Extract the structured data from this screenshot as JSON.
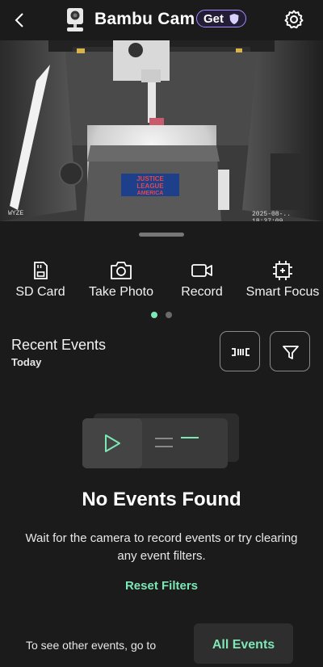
{
  "header": {
    "title": "Bambu Cam",
    "get_badge": "Get"
  },
  "video": {
    "watermark_brand": "WYZE",
    "timestamp": "2025-08-.. 18:37:09",
    "sign_text_line1": "JUSTICE",
    "sign_text_line2": "LEAGUE",
    "sign_text_line3": "AMERICA"
  },
  "actions": [
    {
      "label": "SD Card",
      "icon": "sd-card-icon"
    },
    {
      "label": "Take Photo",
      "icon": "camera-icon"
    },
    {
      "label": "Record",
      "icon": "video-record-icon"
    },
    {
      "label": "Smart Focus",
      "icon": "focus-icon"
    }
  ],
  "pager": {
    "pages": 2,
    "active": 1
  },
  "events": {
    "title": "Recent Events",
    "subtitle": "Today"
  },
  "empty": {
    "title": "No Events Found",
    "description": "Wait for the camera to record events or try clearing any event filters.",
    "reset_label": "Reset Filters"
  },
  "footer": {
    "text": "To see other events, go to",
    "button_label": "All Events"
  },
  "colors": {
    "accent_green": "#7ee7b6",
    "badge_purple": "#a58bff",
    "background": "#1b1b1b"
  }
}
